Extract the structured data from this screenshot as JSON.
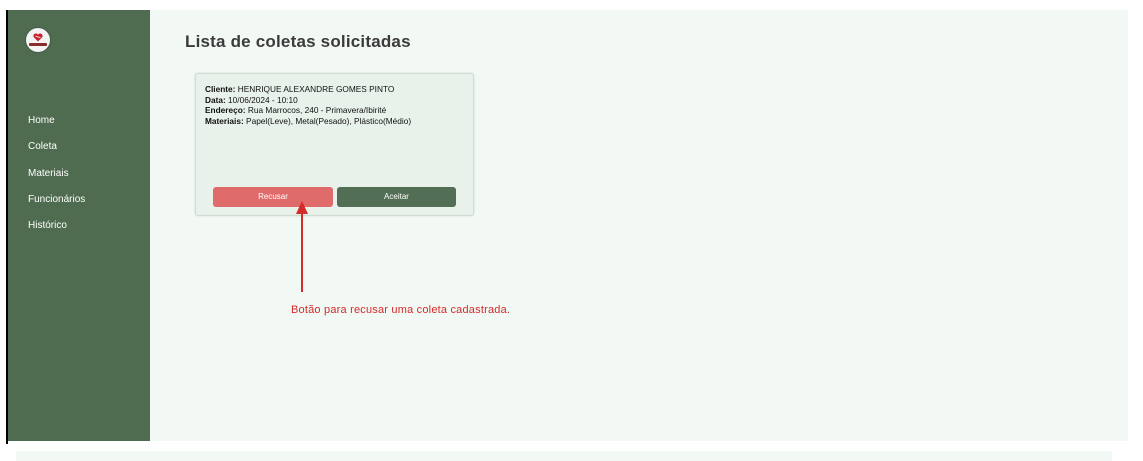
{
  "app": {
    "logo_icon": "heart-logo-icon",
    "brand_color": "#506c50"
  },
  "sidebar": {
    "items": [
      {
        "label": "Home"
      },
      {
        "label": "Coleta"
      },
      {
        "label": "Materiais"
      },
      {
        "label": "Funcionários"
      },
      {
        "label": "Histórico"
      }
    ]
  },
  "main": {
    "title": "Lista de coletas solicitadas",
    "card": {
      "client_label": "Cliente:",
      "client_value": " HENRIQUE ALEXANDRE GOMES PINTO",
      "date_label": "Data:",
      "date_value": " 10/06/2024 - 10:10",
      "address_label": "Endereço:",
      "address_value": " Rua Marrocos, 240 - Primavera/Ibirité",
      "materials_label": "Materiais:",
      "materials_value": " Papel(Leve), Metal(Pesado), Plástico(Médio)",
      "refuse_label": "Recusar",
      "accept_label": "Aceitar",
      "refuse_color": "#e06b6b",
      "accept_color": "#526e54"
    }
  },
  "annotation": {
    "text": "Botão para recusar uma coleta cadastrada.",
    "color": "#d42b2b"
  }
}
